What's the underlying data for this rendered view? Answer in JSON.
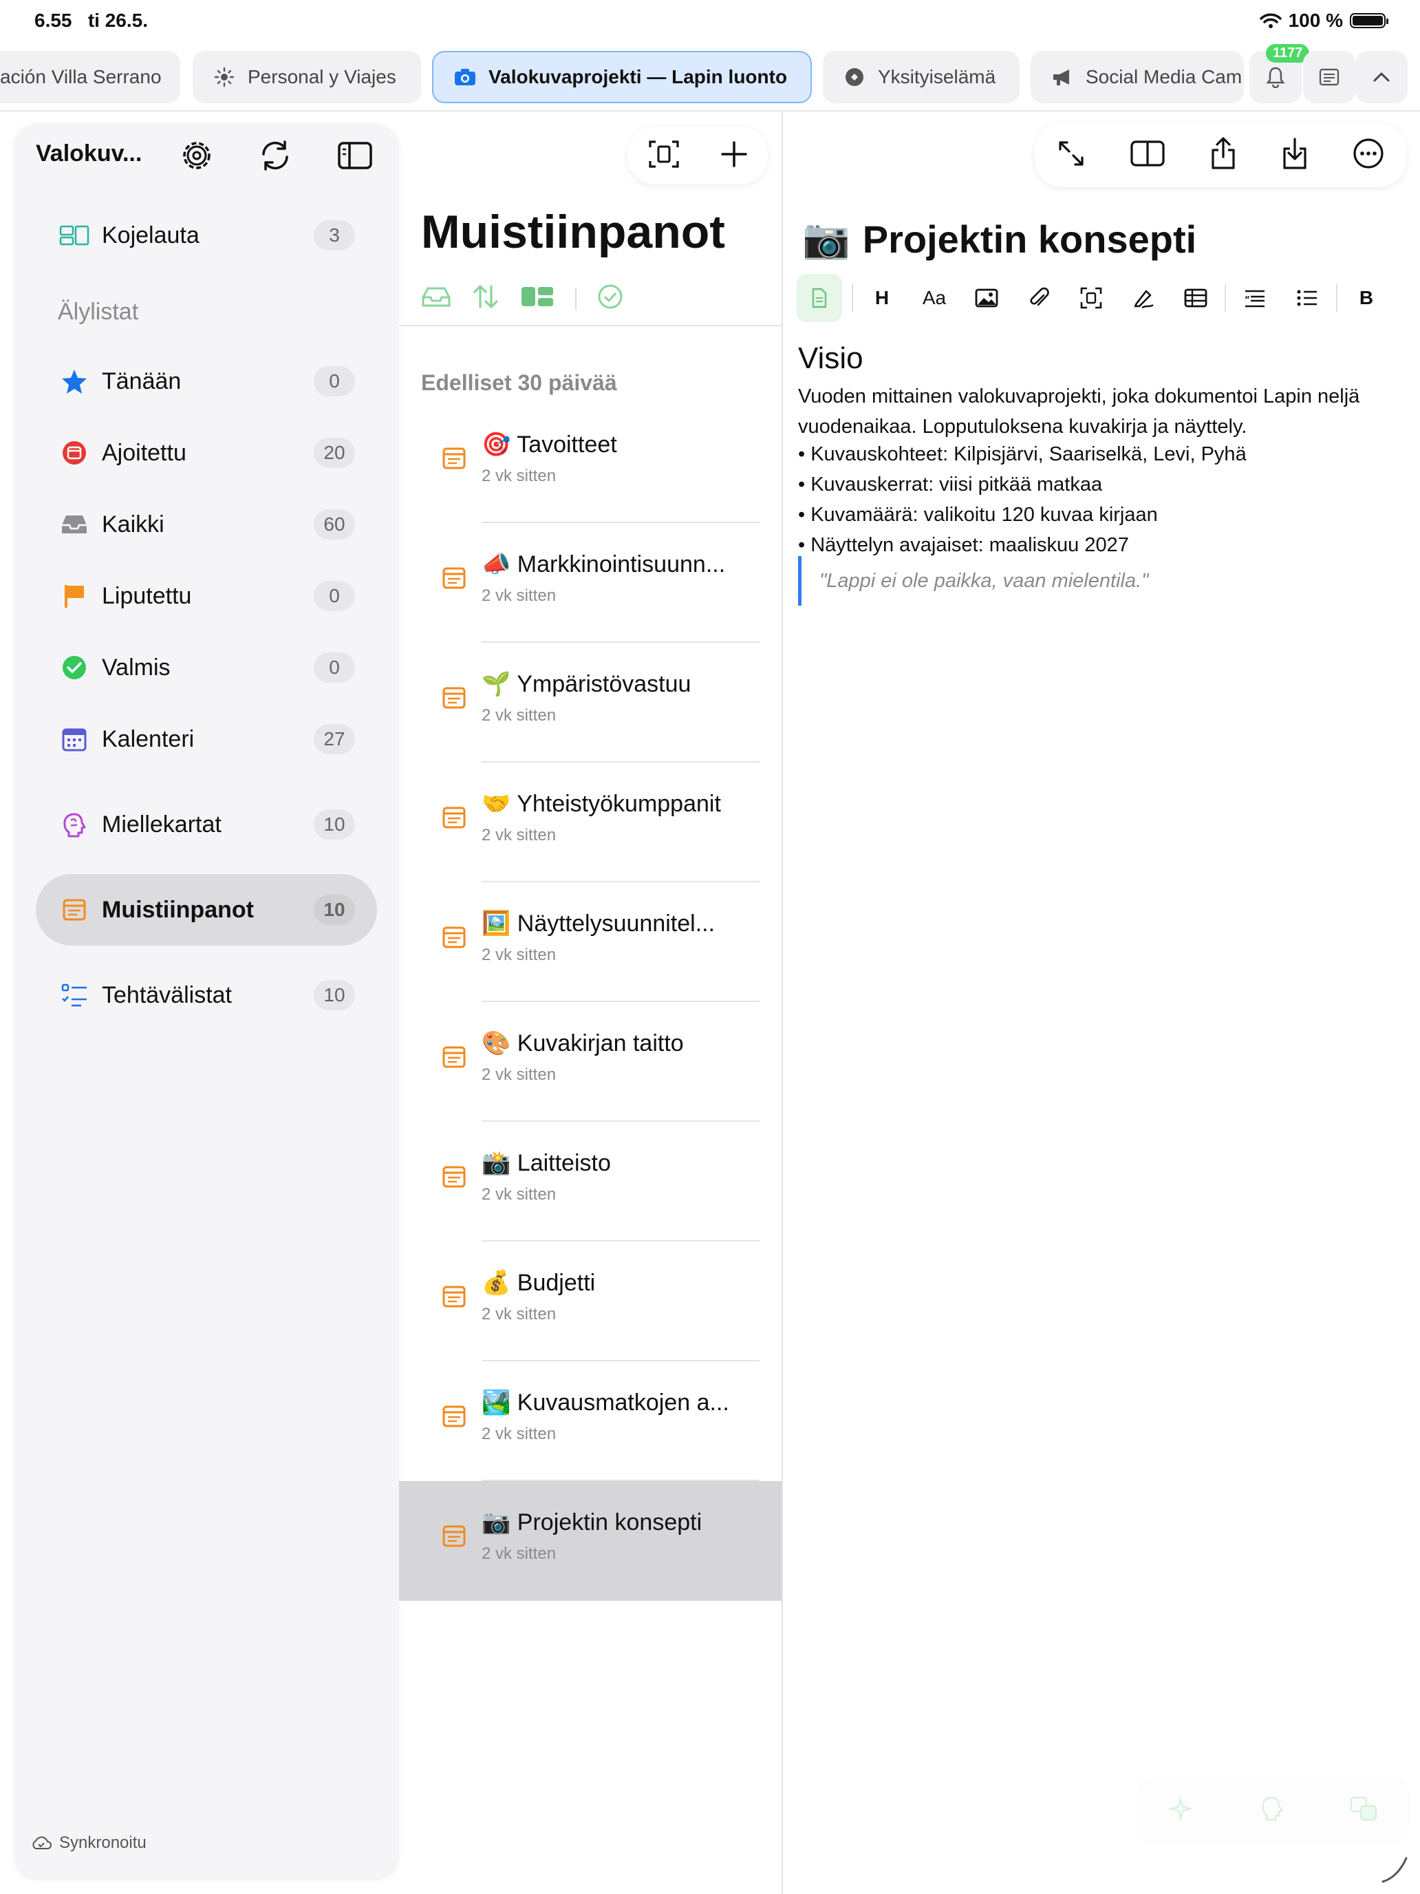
{
  "status": {
    "time": "6.55",
    "date": "ti 26.5.",
    "battery": "100 %"
  },
  "tabs": [
    {
      "label": "ación Villa Serrano"
    },
    {
      "label": "Personal y Viajes"
    },
    {
      "label": "Valokuvaprojekti — Lapin luonto"
    },
    {
      "label": "Yksityiselämä"
    },
    {
      "label": "Social Media Cam"
    }
  ],
  "notifications": {
    "badge": "1177"
  },
  "sidebar": {
    "title": "Valokuv...",
    "dashboard": {
      "label": "Kojelauta",
      "count": "3"
    },
    "smartlists_title": "Älylistat",
    "items": [
      {
        "label": "Tänään",
        "count": "0"
      },
      {
        "label": "Ajoitettu",
        "count": "20"
      },
      {
        "label": "Kaikki",
        "count": "60"
      },
      {
        "label": "Liputettu",
        "count": "0"
      },
      {
        "label": "Valmis",
        "count": "0"
      },
      {
        "label": "Kalenteri",
        "count": "27"
      }
    ],
    "mindmaps": {
      "label": "Miellekartat",
      "count": "10"
    },
    "notes": {
      "label": "Muistiinpanot",
      "count": "10"
    },
    "tasklists": {
      "label": "Tehtävälistat",
      "count": "10"
    },
    "sync_label": "Synkronoitu"
  },
  "notes_panel": {
    "title": "Muistiinpanot",
    "section": "Edelliset 30 päivää",
    "notes": [
      {
        "emoji": "🎯",
        "title": "Tavoitteet",
        "time": "2 vk sitten"
      },
      {
        "emoji": "📣",
        "title": "Markkinointisuunn...",
        "time": "2 vk sitten"
      },
      {
        "emoji": "🌱",
        "title": "Ympäristövastuu",
        "time": "2 vk sitten"
      },
      {
        "emoji": "🤝",
        "title": "Yhteistyökumppanit",
        "time": "2 vk sitten"
      },
      {
        "emoji": "🖼️",
        "title": "Näyttelysuunnitel...",
        "time": "2 vk sitten"
      },
      {
        "emoji": "🎨",
        "title": "Kuvakirjan taitto",
        "time": "2 vk sitten"
      },
      {
        "emoji": "📸",
        "title": "Laitteisto",
        "time": "2 vk sitten"
      },
      {
        "emoji": "💰",
        "title": "Budjetti",
        "time": "2 vk sitten"
      },
      {
        "emoji": "🏞️",
        "title": "Kuvausmatkojen a...",
        "time": "2 vk sitten"
      },
      {
        "emoji": "📷",
        "title": "Projektin konsepti",
        "time": "2 vk sitten"
      }
    ]
  },
  "editor": {
    "emoji": "📷",
    "title": "Projektin konsepti",
    "toolbar": {
      "heading": "H",
      "font": "Aa",
      "bold": "B"
    },
    "heading": "Visio",
    "paragraph": "Vuoden mittainen valokuvaprojekti, joka dokumentoi Lapin neljä vuodenaikaa. Lopputuloksena kuvakirja ja näyttely.",
    "bullets": [
      "• Kuvauskohteet: Kilpisjärvi, Saariselkä, Levi, Pyhä",
      "• Kuvauskerrat: viisi pitkää matkaa",
      "• Kuvamäärä: valikoitu 120 kuvaa kirjaan",
      "• Näyttelyn avajaiset: maaliskuu 2027"
    ],
    "quote": "\"Lappi ei ole paikka, vaan mielentila.\""
  }
}
